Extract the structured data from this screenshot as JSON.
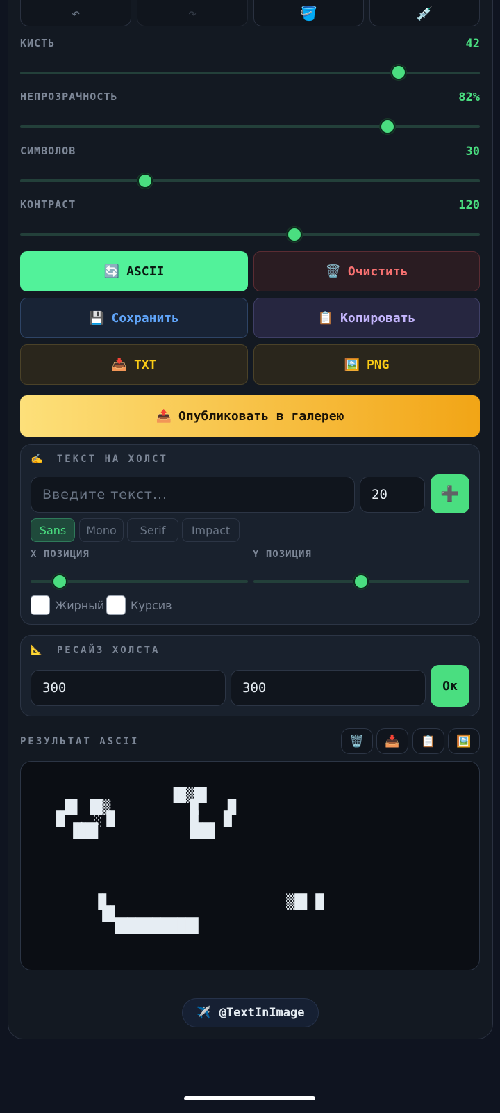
{
  "toolbar": {
    "undo_icon": "↶",
    "redo_icon": "↷",
    "fill_icon": "🪣",
    "picker_icon": "💉"
  },
  "sliders": {
    "brush": {
      "label": "КИСТЬ",
      "value": "42",
      "level": 0.82
    },
    "opacity": {
      "label": "НЕПРОЗРАЧНОСТЬ",
      "value": "82%",
      "level": 0.8
    },
    "chars": {
      "label": "СИМВОЛОВ",
      "value": "30",
      "level": 0.27
    },
    "contrast": {
      "label": "КОНТРАСТ",
      "value": "120",
      "level": 0.6
    }
  },
  "actions": {
    "ascii": {
      "icon": "🔄",
      "label": "ASCII"
    },
    "clear": {
      "icon": "🗑️",
      "label": "Очистить"
    },
    "save": {
      "icon": "💾",
      "label": "Сохранить"
    },
    "copy": {
      "icon": "📋",
      "label": "Копировать"
    },
    "txt": {
      "icon": "📥",
      "label": "TXT"
    },
    "png": {
      "icon": "🖼️",
      "label": "PNG"
    },
    "publish": {
      "icon": "📤",
      "label": "Опубликовать в галерею"
    }
  },
  "text_card": {
    "title_icon": "✍️",
    "title": "ТЕКСТ НА ХОЛСТ",
    "text_placeholder": "Введите текст...",
    "size_value": "20",
    "add_icon": "➕",
    "fonts": [
      "Sans",
      "Mono",
      "Serif",
      "Impact"
    ],
    "selected_font": "Sans",
    "x_label": "X ПОЗИЦИЯ",
    "y_label": "Y ПОЗИЦИЯ",
    "x_level": 0.17,
    "y_level": 0.5,
    "bold_label": "Жирный",
    "italic_label": "Курсив"
  },
  "resize_card": {
    "title_icon": "📐",
    "title": "РЕСАЙЗ ХОЛСТА",
    "width": "300",
    "height": "300",
    "ok_label": "Ок"
  },
  "result": {
    "title": "РЕЗУЛЬТАТ ASCII",
    "icons": [
      "🗑️",
      "📥",
      "📋",
      "🖼️"
    ],
    "ascii_art": "              ▐█▒█▌\n ▐█ ▐█▒         ▐▌   █\n▐▌ . ░▐▌        ▐▌  ▐▌\n  ▐██▌          ▐██▌\n\n\n\n\n\n     ▐▌                     ▒█▌▐▌\n      █▌\n       ▐█████████▌"
  },
  "footer": {
    "icon": "✈️",
    "handle": "@TextInImage"
  },
  "colors": {
    "accent": "#4ade80",
    "background": "#0f1420",
    "clear_text": "#f87171",
    "save_text": "#60a5fa",
    "copy_text": "#c4b5fd",
    "export_text": "#facc15",
    "publish_gradient_start": "#fde68a",
    "publish_gradient_end": "#f59e0b"
  }
}
